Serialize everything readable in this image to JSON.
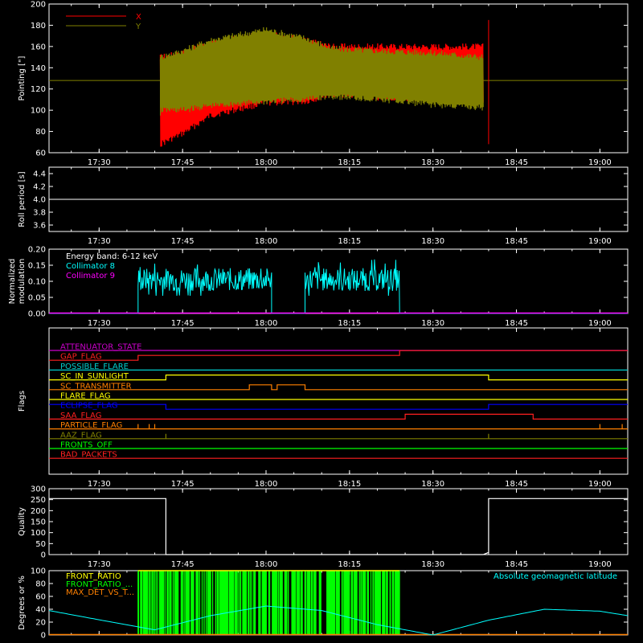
{
  "chart_data": [
    {
      "type": "line",
      "ylabel": "Pointing [\"]",
      "ylim": [
        60,
        200
      ],
      "yticks": [
        60,
        80,
        100,
        120,
        140,
        160,
        180,
        200
      ],
      "xticks": [
        "17:30",
        "17:45",
        "18:00",
        "18:15",
        "18:30",
        "18:45",
        "19:00"
      ],
      "xrange": [
        "17:21",
        "19:05"
      ],
      "legend_placement": "top-left",
      "baseline_value": 128,
      "series": [
        {
          "name": "X",
          "color": "#ff0000",
          "x": [
            "17:41",
            "17:45",
            "17:50",
            "18:00",
            "18:07",
            "18:12",
            "18:20",
            "18:30",
            "18:39"
          ],
          "upper": [
            150,
            154,
            163,
            172,
            166,
            160,
            160,
            160,
            160
          ],
          "lower": [
            68,
            78,
            95,
            107,
            108,
            115,
            112,
            110,
            110
          ]
        },
        {
          "name": "Y",
          "color": "#808000",
          "x": [
            "17:41",
            "17:45",
            "17:50",
            "18:00",
            "18:07",
            "18:12",
            "18:20",
            "18:30",
            "18:39"
          ],
          "upper": [
            150,
            156,
            166,
            176,
            168,
            158,
            156,
            154,
            150
          ],
          "lower": [
            100,
            100,
            104,
            108,
            110,
            113,
            110,
            105,
            102
          ]
        }
      ]
    },
    {
      "type": "line",
      "ylabel": "Roll period [s]",
      "ylim": [
        3.5,
        4.5
      ],
      "yticks": [
        "3.6",
        "3.8",
        "4.0",
        "4.2",
        "4.4"
      ],
      "ytick_values": [
        3.6,
        3.8,
        4.0,
        4.2,
        4.4
      ],
      "xticks": [
        "17:30",
        "17:45",
        "18:00",
        "18:15",
        "18:30",
        "18:45",
        "19:00"
      ],
      "series": [
        {
          "name": "",
          "color": "#ffffff",
          "x": [
            "17:21",
            "19:05"
          ],
          "y": [
            4.0,
            4.0
          ]
        }
      ]
    },
    {
      "type": "line",
      "ylabel": "Normalized modulation",
      "ylabel_lines": [
        "Normalized",
        "modulation"
      ],
      "ylim": [
        0,
        0.2
      ],
      "yticks": [
        "0.00",
        "0.05",
        "0.10",
        "0.15",
        "0.20"
      ],
      "ytick_values": [
        0,
        0.05,
        0.1,
        0.15,
        0.2
      ],
      "xticks": [
        "17:30",
        "17:45",
        "18:00",
        "18:15",
        "18:30",
        "18:45",
        "19:00"
      ],
      "annotation": "Energy band: 6-12 keV",
      "series": [
        {
          "name": "Collimator 8",
          "color": "#00ffff",
          "segments": [
            {
              "start": "17:37",
              "end": "18:01",
              "mean": 0.105,
              "spread": 0.045
            },
            {
              "start": "18:07",
              "end": "18:24",
              "mean": 0.105,
              "spread": 0.045
            }
          ]
        },
        {
          "name": "Collimator 9",
          "color": "#ff00ff",
          "constant": 0.0
        }
      ]
    },
    {
      "type": "line",
      "ylabel": "Flags",
      "xticks": [
        "17:30",
        "17:45",
        "18:00",
        "18:15",
        "18:30",
        "18:45",
        "19:00"
      ],
      "flags": [
        {
          "name": "ATTENUATOR_STATE",
          "color": "#cc00cc",
          "steps": []
        },
        {
          "name": "GAP_FLAG",
          "color": "#ff2020",
          "steps": [
            [
              "17:21",
              0
            ],
            [
              "17:37",
              1
            ],
            [
              "18:24",
              2
            ]
          ]
        },
        {
          "name": "POSSIBLE_FLARE",
          "color": "#00cccc",
          "steps": []
        },
        {
          "name": "SC_IN_SUNLIGHT",
          "color": "#ffff00",
          "steps": [
            [
              "17:21",
              0
            ],
            [
              "17:42",
              1
            ],
            [
              "18:40",
              0
            ]
          ]
        },
        {
          "name": "SC_TRANSMITTER",
          "color": "#ff8000",
          "steps": [
            [
              "17:21",
              0
            ],
            [
              "17:57",
              1
            ],
            [
              "18:01",
              0
            ],
            [
              "18:02",
              1
            ],
            [
              "18:07",
              0
            ]
          ]
        },
        {
          "name": "FLARE_FLAG",
          "color": "#ffff00",
          "steps": []
        },
        {
          "name": "ECLIPSE_FLAG",
          "color": "#0000ff",
          "steps": [
            [
              "17:21",
              1
            ],
            [
              "17:42",
              0
            ],
            [
              "18:40",
              1
            ]
          ]
        },
        {
          "name": "SAA_FLAG",
          "color": "#ff2020",
          "steps": [
            [
              "17:21",
              0
            ],
            [
              "18:25",
              1
            ],
            [
              "18:48",
              0
            ]
          ]
        },
        {
          "name": "PARTICLE_FLAG",
          "color": "#ff8000",
          "spikes": [
            "17:37",
            "17:39",
            "17:40",
            "19:00",
            "19:04"
          ]
        },
        {
          "name": "AAZ_FLAG",
          "color": "#808000",
          "spikes": [
            "17:42",
            "18:40"
          ]
        },
        {
          "name": "FRONTS_OFF",
          "color": "#00ff00",
          "steps": []
        },
        {
          "name": "BAD_PACKETS",
          "color": "#ff2020",
          "steps": []
        }
      ]
    },
    {
      "type": "line",
      "ylabel": "Quality",
      "ylim": [
        0,
        300
      ],
      "yticks": [
        "0",
        "50",
        "100",
        "150",
        "200",
        "250",
        "300"
      ],
      "ytick_values": [
        0,
        50,
        100,
        150,
        200,
        250,
        300
      ],
      "xticks": [
        "17:30",
        "17:45",
        "18:00",
        "18:15",
        "18:30",
        "18:45",
        "19:00"
      ],
      "series": [
        {
          "name": "",
          "color": "#ffffff",
          "x": [
            "17:21",
            "17:42",
            "17:42",
            "18:39",
            "18:40",
            "18:40",
            "19:05"
          ],
          "y": [
            255,
            255,
            0,
            0,
            10,
            255,
            255
          ]
        }
      ]
    },
    {
      "type": "line",
      "ylabel": "Degrees or %",
      "ylim": [
        0,
        100
      ],
      "yticks": [
        "0",
        "20",
        "40",
        "60",
        "80",
        "100"
      ],
      "ytick_values": [
        0,
        20,
        40,
        60,
        80,
        100
      ],
      "xticks": [
        "17:30",
        "17:45",
        "18:00",
        "18:15",
        "18:30",
        "18:45",
        "19:00"
      ],
      "annotation": "Absolute geomagnetic latitude",
      "series": [
        {
          "name": "FRONT_RATIO",
          "color": "#ffff00",
          "segments": [
            {
              "start": "17:37",
              "end": "18:24",
              "level": 100
            }
          ]
        },
        {
          "name": "FRONT_RATIO_...",
          "color": "#00ff00",
          "segments": [
            {
              "start": "17:37",
              "end": "18:24",
              "max": 100
            }
          ]
        },
        {
          "name": "MAX_DET_VS_T...",
          "color": "#ff8000",
          "constant": 0
        },
        {
          "name": "Absolute geomagnetic latitude",
          "color": "#00ffff",
          "x": [
            "17:21",
            "17:31",
            "17:40",
            "17:50",
            "18:00",
            "18:10",
            "18:20",
            "18:30",
            "18:40",
            "18:50",
            "19:00",
            "19:05"
          ],
          "y": [
            38,
            22,
            8,
            30,
            45,
            38,
            16,
            0,
            23,
            40,
            37,
            30
          ]
        }
      ]
    }
  ]
}
